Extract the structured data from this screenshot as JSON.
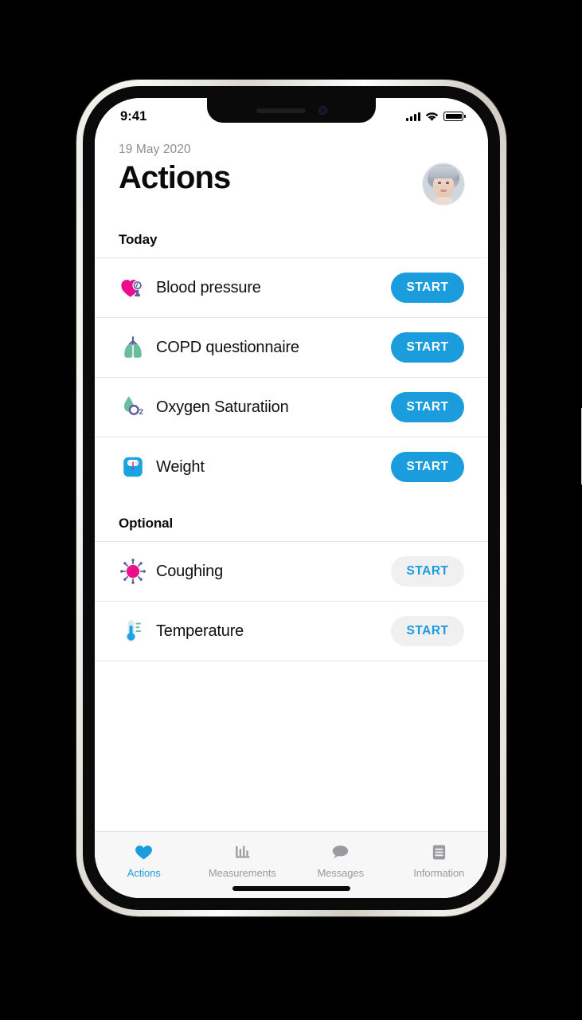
{
  "status_bar": {
    "time": "9:41",
    "signal_icon": "cellular-signal-icon",
    "wifi_icon": "wifi-icon",
    "battery_icon": "battery-full-icon"
  },
  "header": {
    "date": "19 May 2020",
    "title": "Actions",
    "avatar_alt": "user-avatar"
  },
  "colors": {
    "accent_blue": "#1b9ddd",
    "magenta": "#ec0d8c",
    "green": "#6bbd9b",
    "purple": "#5a5e9b",
    "secondary_button_bg": "#f0f0f1",
    "divider": "#e6e6e8",
    "tab_inactive": "#9a9a9f",
    "date_gray": "#8d8d92"
  },
  "sections": [
    {
      "title": "Today",
      "items": [
        {
          "label": "Blood pressure",
          "icon": "blood-pressure-icon",
          "button_label": "START",
          "button_style": "primary"
        },
        {
          "label": "COPD questionnaire",
          "icon": "lungs-icon",
          "button_label": "START",
          "button_style": "primary"
        },
        {
          "label": "Oxygen Saturatiion",
          "icon": "oxygen-saturation-icon",
          "button_label": "START",
          "button_style": "primary"
        },
        {
          "label": "Weight",
          "icon": "weight-scale-icon",
          "button_label": "START",
          "button_style": "primary"
        }
      ]
    },
    {
      "title": "Optional",
      "items": [
        {
          "label": "Coughing",
          "icon": "virus-icon",
          "button_label": "START",
          "button_style": "secondary"
        },
        {
          "label": "Temperature",
          "icon": "thermometer-icon",
          "button_label": "START",
          "button_style": "secondary"
        }
      ]
    }
  ],
  "tabs": [
    {
      "label": "Actions",
      "icon": "heart-icon",
      "active": true
    },
    {
      "label": "Measurements",
      "icon": "bar-chart-icon",
      "active": false
    },
    {
      "label": "Messages",
      "icon": "speech-bubble-icon",
      "active": false
    },
    {
      "label": "Information",
      "icon": "document-icon",
      "active": false
    }
  ]
}
